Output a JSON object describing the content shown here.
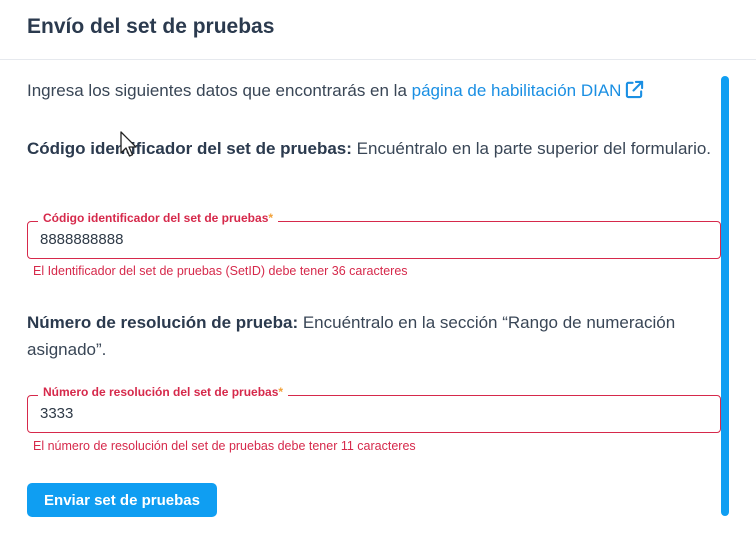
{
  "header": {
    "title": "Envío del set de pruebas"
  },
  "intro": {
    "text": "Ingresa los siguientes datos que encontrarás en la ",
    "link_text": "página de habilitación DIAN",
    "link_icon": "external-link-icon"
  },
  "set_id_section": {
    "label_bold": "Código identificador del set de pruebas:",
    "label_rest": " Encuéntralo en la parte superior del formulario.",
    "field_label": "Código identificador del set de pruebas",
    "required_mark": "*",
    "value": "8888888888",
    "error": "El Identificador del set de pruebas (SetID) debe tener 36 caracteres"
  },
  "resolution_section": {
    "label_bold": "Número de resolución de prueba:",
    "label_rest": " Encuéntralo en la sección “Rango de numeración asignado”.",
    "field_label": "Número de resolución del set de pruebas",
    "required_mark": "*",
    "value": "3333",
    "error": "El número de resolución del set de pruebas debe tener 11 caracteres"
  },
  "actions": {
    "submit_label": "Enviar set de pruebas"
  },
  "colors": {
    "accent": "#0f9ef2",
    "link": "#1a8fe3",
    "error": "#d6294b",
    "required": "#f2a23a",
    "heading": "#2b3a4e"
  }
}
